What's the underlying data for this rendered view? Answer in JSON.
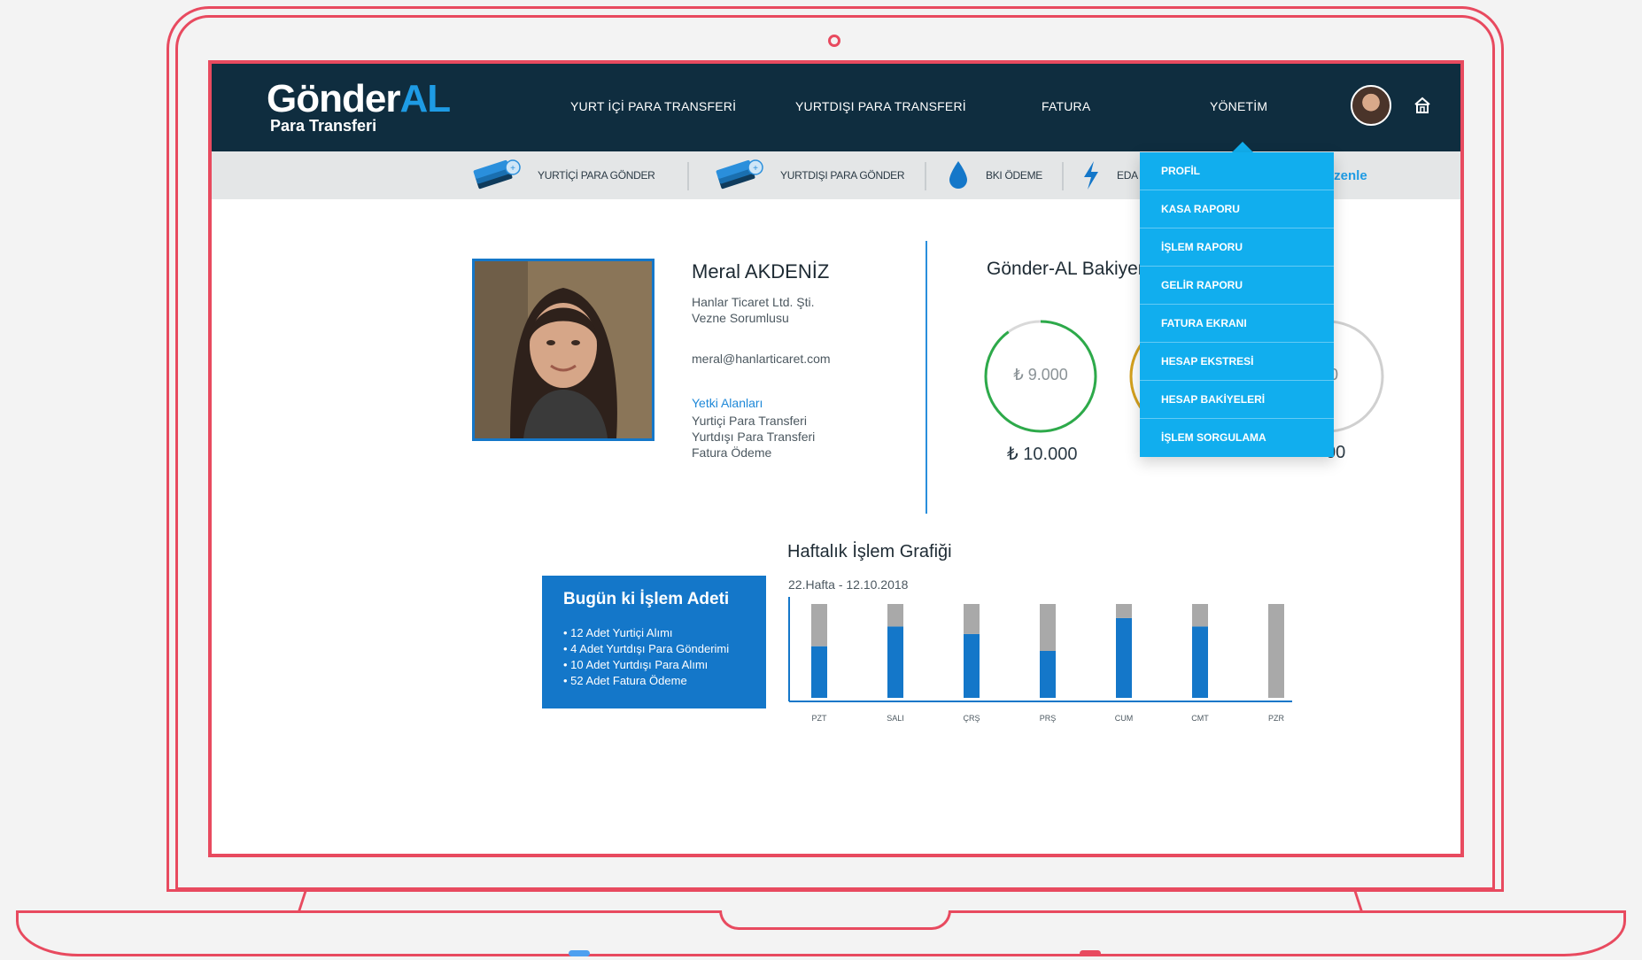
{
  "topnav": {
    "logo_main": "Gönder",
    "logo_accent": "AL",
    "logo_sub": "Para Transferi",
    "items": [
      {
        "label": "YURT İÇİ PARA TRANSFERİ"
      },
      {
        "label": "YURTDIŞI PARA TRANSFERİ"
      },
      {
        "label": "FATURA"
      },
      {
        "label": "YÖNETİM"
      }
    ]
  },
  "subnav": {
    "items": [
      {
        "label": "YURTİÇİ PARA GÖNDER",
        "icon": "money-stack-icon"
      },
      {
        "label": "YURTDIŞI PARA GÖNDER",
        "icon": "money-stack-icon"
      },
      {
        "label": "BKI ÖDEME",
        "icon": "water-drop-icon"
      },
      {
        "label": "EDA",
        "icon": "lightning-icon"
      }
    ],
    "right_link": "izenle"
  },
  "dropdown": {
    "items": [
      "PROFİL",
      "KASA RAPORU",
      "İŞLEM RAPORU",
      "GELİR RAPORU",
      "FATURA EKRANI",
      "HESAP EKSTRESİ",
      "HESAP BAKİYELERİ",
      "İŞLEM SORGULAMA"
    ]
  },
  "profile": {
    "name": "Meral AKDENİZ",
    "company": "Hanlar Ticaret Ltd. Şti.",
    "role": "Vezne Sorumlusu",
    "email": "meral@hanlarticaret.com",
    "permissions_title": "Yetki Alanları",
    "permissions": [
      "Yurtiçi Para Transferi",
      "Yurtdışı Para Transferi",
      "Fatura Ödeme"
    ]
  },
  "balance": {
    "title": "Gönder-AL Bakiyeniz",
    "rings": [
      {
        "value": "₺ 9.000",
        "limit": "₺ 10.000",
        "fraction": 0.9,
        "color": "#2daa4a"
      },
      {
        "value": "",
        "limit": "",
        "fraction": 0.5,
        "color": "#d6a21e"
      },
      {
        "value": "0",
        "limit": "00",
        "fraction": 0.0,
        "color": "#c7c7c7"
      }
    ]
  },
  "today": {
    "title": "Bugün ki İşlem Adeti",
    "items": [
      "• 12 Adet Yurtiçi Alımı",
      "• 4 Adet Yurtdışı Para Gönderimi",
      "• 10 Adet Yurtdışı Para Alımı",
      "• 52 Adet Fatura Ödeme"
    ]
  },
  "chart_data": {
    "type": "bar",
    "title": "Haftalık İşlem Grafiği",
    "subtitle": "22.Hafta - 12.10.2018",
    "categories": [
      "PZT",
      "SALI",
      "ÇRŞ",
      "PRŞ",
      "CUM",
      "CMT",
      "PZR"
    ],
    "series": [
      {
        "values": [
          0.55,
          0.76,
          0.68,
          0.5,
          0.85,
          0.76,
          0.0
        ],
        "color": "#1477c9"
      },
      {
        "values": [
          0.45,
          0.24,
          0.32,
          0.5,
          0.15,
          0.24,
          1.0
        ],
        "color": "#a9a9a9"
      }
    ],
    "ylim": [
      0,
      1
    ]
  }
}
